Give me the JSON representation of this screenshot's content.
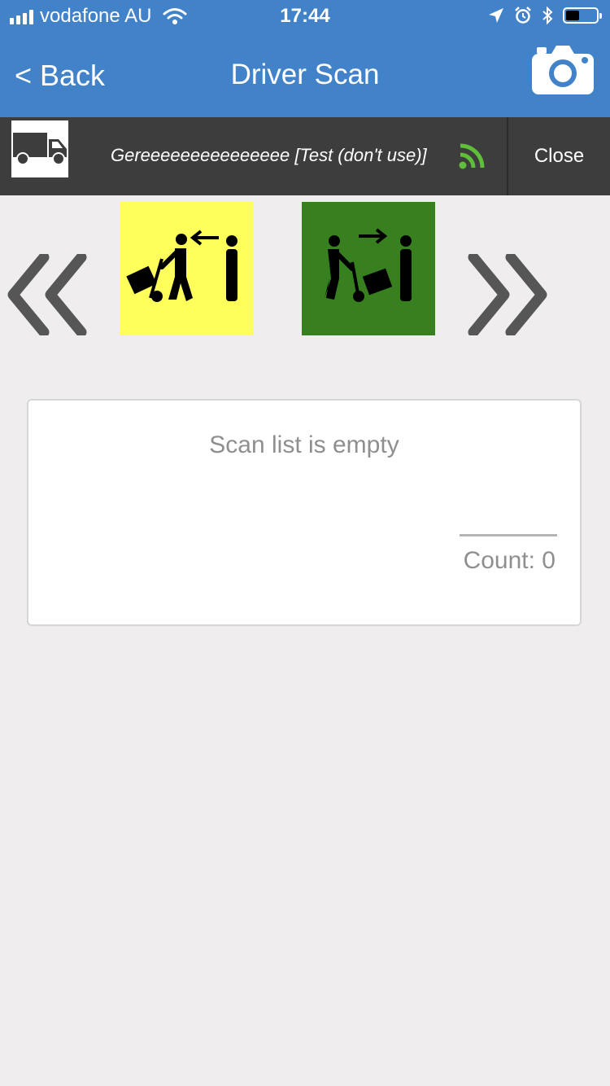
{
  "status_bar": {
    "carrier": "vodafone AU",
    "time": "17:44"
  },
  "nav": {
    "back_label": "< Back",
    "title": "Driver Scan"
  },
  "driver_bar": {
    "driver_name": "Gereeeeeeeeeeeeeee [Test (don't use)]",
    "close_label": "Close"
  },
  "modes": [
    {
      "name": "receive",
      "color": "#feff5a"
    },
    {
      "name": "deliver",
      "color": "#38801f"
    }
  ],
  "scan_list": {
    "empty_text": "Scan list is empty",
    "count_label": "Count: 0"
  },
  "colors": {
    "header": "#4282c8",
    "driver_bar": "#3d3d3d",
    "background": "#efedee",
    "signal_green": "#5fbf3a"
  }
}
